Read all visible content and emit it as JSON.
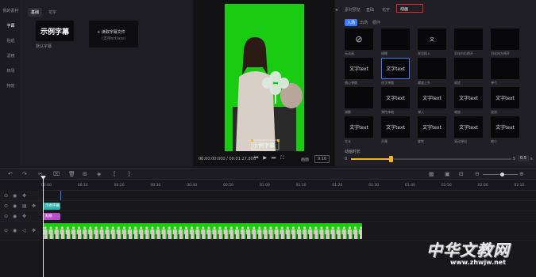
{
  "leftnav": {
    "items": [
      "我的素材",
      "字幕",
      "贴纸",
      "滤镜",
      "转场",
      "特效"
    ]
  },
  "assets": {
    "tabs": [
      "基础",
      "花字"
    ],
    "preset_text": "示例字幕",
    "preset_caption": "默认字幕",
    "import_title": "+ 读取字幕文件",
    "import_sub": "(支持srt/ass)"
  },
  "preview": {
    "subtitle": "示例字幕",
    "timecode": "00:00:00.000 / 00:01:27.800",
    "ratio": "画面",
    "zoom": "9:16"
  },
  "rightpanel": {
    "tabs": [
      "素材预览",
      "基础",
      "花字",
      "动画"
    ],
    "subtabs": [
      "入场",
      "出场",
      "循环"
    ],
    "cells": [
      {
        "text": "⊘",
        "label": "无动画"
      },
      {
        "text": "",
        "label": "模糊"
      },
      {
        "text": "文",
        "label": "渐显插入"
      },
      {
        "text": "",
        "label": "羽化向右擦开"
      },
      {
        "text": "",
        "label": "羽化向左擦开"
      },
      {
        "text": "文字text",
        "label": "随心弹跳"
      },
      {
        "text": "文字text",
        "label": "逐字弹跳"
      },
      {
        "text": "",
        "label": "螺旋上升"
      },
      {
        "text": "",
        "label": "收拢"
      },
      {
        "text": "",
        "label": "弹弓"
      },
      {
        "text": "",
        "label": "溶解"
      },
      {
        "text": "文字text",
        "label": "弹性伸缩"
      },
      {
        "text": "文字text",
        "label": "弹入"
      },
      {
        "text": "文字text",
        "label": "缩放"
      },
      {
        "text": "文字text",
        "label": "波浪"
      },
      {
        "text": "文字text",
        "label": "生长"
      },
      {
        "text": "文字text",
        "label": "开幕"
      },
      {
        "text": "文字text",
        "label": "旋转"
      },
      {
        "text": "文字text",
        "label": "晃动弹出"
      },
      {
        "text": "文字text",
        "label": "缩小"
      }
    ],
    "duration_label": "动画时长",
    "duration_min": "0",
    "duration_max": "5",
    "duration_value": "0.5",
    "duration_unit": "s"
  },
  "timeline": {
    "ticks": [
      "00:00",
      "00:10",
      "00:20",
      "00:30",
      "00:40",
      "00:50",
      "01:00",
      "01:10",
      "01:20",
      "01:30",
      "01:40",
      "01:50",
      "02:00",
      "02:10"
    ],
    "text_clip": "示例字幕",
    "sticker_clip": "贴纸",
    "video_clip_label": "视频素材"
  },
  "watermark": {
    "brand": "中华文教网",
    "url": "www.zhwjw.net"
  },
  "colors": {
    "accent": "#3a7bff",
    "green_screen": "#19cc11",
    "text_clip": "#2bb5a8",
    "sticker_clip": "#b74fc9",
    "highlight": "#e02b2b"
  }
}
